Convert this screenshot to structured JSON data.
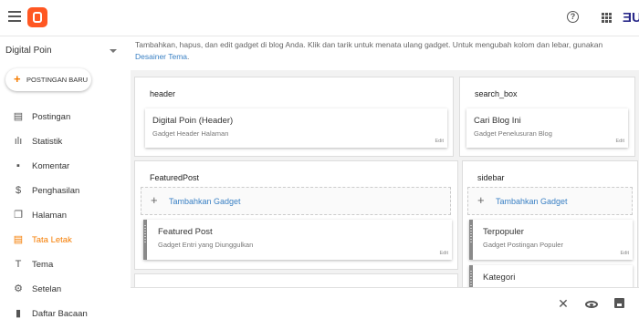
{
  "app": {
    "brand_color": "#ff5722",
    "accent_color": "#f57c00",
    "link_color": "#3a80c4"
  },
  "topbar": {
    "help_icon": "?",
    "avatar_text": "ƎU"
  },
  "sidebar": {
    "blog_name": "Digital Poin",
    "new_post_label": "POSTINGAN BARU",
    "items": [
      {
        "label": "Postingan",
        "icon": "▤"
      },
      {
        "label": "Statistik",
        "icon": "ılı"
      },
      {
        "label": "Komentar",
        "icon": "▪"
      },
      {
        "label": "Penghasilan",
        "icon": "$"
      },
      {
        "label": "Halaman",
        "icon": "❐"
      },
      {
        "label": "Tata Letak",
        "icon": "▤",
        "active": true
      },
      {
        "label": "Tema",
        "icon": "T"
      },
      {
        "label": "Setelan",
        "icon": "⚙"
      },
      {
        "label": "Daftar Bacaan",
        "icon": "▮"
      }
    ]
  },
  "main": {
    "intro_text": "Tambahkan, hapus, dan edit gadget di blog Anda. Klik dan tarik untuk menata ulang gadget. Untuk mengubah kolom dan lebar, gunakan",
    "intro_link": "Desainer Tema",
    "intro_end": ".",
    "sections": {
      "header": {
        "title": "header",
        "gadget": {
          "name": "Digital Poin (Header)",
          "sub": "Gadget Header Halaman",
          "edit": "Edit"
        }
      },
      "search_box": {
        "title": "search_box",
        "gadget": {
          "name": "Cari Blog Ini",
          "sub": "Gadget Penelusuran Blog",
          "edit": "Edit"
        }
      },
      "featured": {
        "title": "FeaturedPost",
        "add_label": "Tambahkan Gadget",
        "gadget": {
          "name": "Featured Post",
          "sub": "Gadget Entri yang Diunggulkan",
          "edit": "Edit"
        }
      },
      "sidebar": {
        "title": "sidebar",
        "add_label": "Tambahkan Gadget",
        "gadgets": [
          {
            "name": "Terpopuler",
            "sub": "Gadget Postingan Populer",
            "edit": "Edit"
          },
          {
            "name": "Kategori",
            "sub": "",
            "edit": ""
          }
        ]
      }
    }
  },
  "footer": {
    "close_icon": "✕"
  }
}
